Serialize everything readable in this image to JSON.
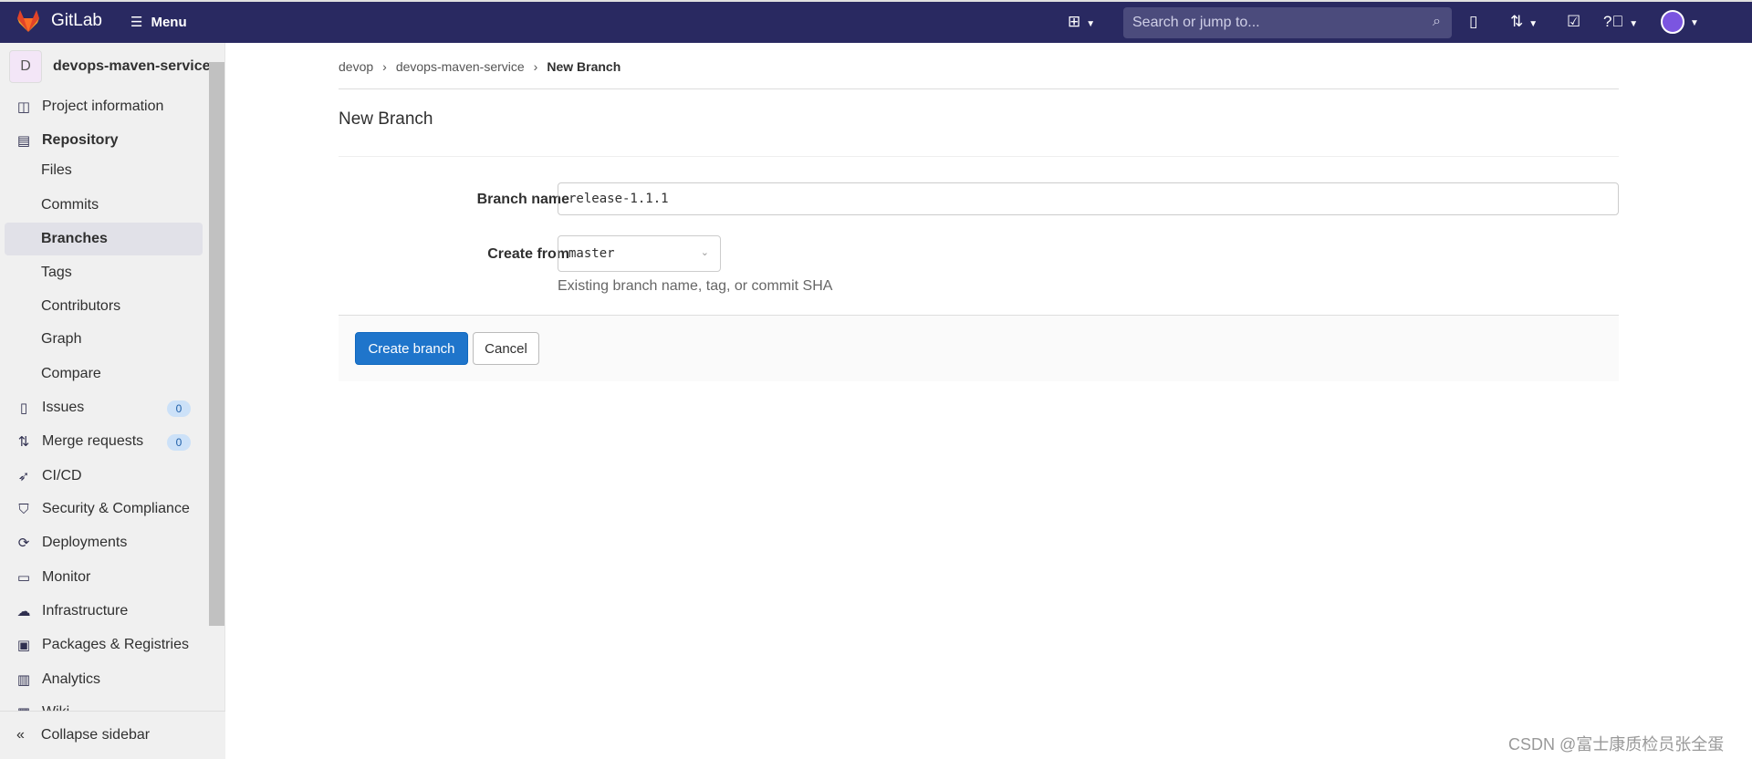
{
  "nav": {
    "brand": "GitLab",
    "menu": "Menu",
    "search_placeholder": "Search or jump to...",
    "icons": [
      "plus-square-icon",
      "search-icon",
      "issues-icon",
      "merge-request-icon",
      "todo-icon",
      "help-icon",
      "avatar"
    ]
  },
  "sidebar": {
    "project_initial": "D",
    "project": "devops-maven-service",
    "items": [
      {
        "label": "Project information",
        "icon": "project-icon"
      },
      {
        "label": "Repository",
        "icon": "document-icon"
      },
      {
        "label": "Issues",
        "icon": "issues-icon",
        "badge": "0"
      },
      {
        "label": "Merge requests",
        "icon": "merge-request-icon",
        "badge": "0"
      },
      {
        "label": "CI/CD",
        "icon": "rocket-icon"
      },
      {
        "label": "Security & Compliance",
        "icon": "shield-icon"
      },
      {
        "label": "Deployments",
        "icon": "deployments-icon"
      },
      {
        "label": "Monitor",
        "icon": "monitor-icon"
      },
      {
        "label": "Infrastructure",
        "icon": "cloud-icon"
      },
      {
        "label": "Packages & Registries",
        "icon": "package-icon"
      },
      {
        "label": "Analytics",
        "icon": "chart-icon"
      },
      {
        "label": "Wiki",
        "icon": "book-icon"
      }
    ],
    "repo_sub": [
      "Files",
      "Commits",
      "Branches",
      "Tags",
      "Contributors",
      "Graph",
      "Compare"
    ],
    "active": "Branches",
    "collapse": "Collapse sidebar"
  },
  "breadcrumb": [
    "devop",
    "devops-maven-service",
    "New Branch"
  ],
  "page": {
    "title": "New Branch",
    "branch_label": "Branch name",
    "branch_value": "release-1.1.1",
    "from_label": "Create from",
    "from_value": "master",
    "help": "Existing branch name, tag, or commit SHA",
    "create": "Create branch",
    "cancel": "Cancel"
  },
  "watermark": "CSDN @富士康质检员张全蛋",
  "colors": {
    "nav": "#292961",
    "primary": "#1f75cb"
  }
}
